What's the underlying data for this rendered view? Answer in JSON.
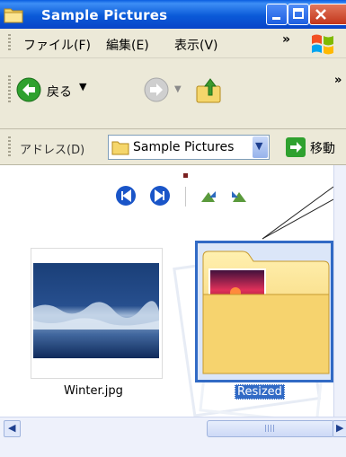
{
  "window": {
    "title": "Sample Pictures",
    "titlebar_color": "#0a5ee0"
  },
  "menu": {
    "items": [
      "ファイル(F)",
      "編集(E)",
      "表示(V)"
    ],
    "overflow": "»"
  },
  "toolbar": {
    "back_label": "戻る",
    "overflow": "»"
  },
  "address": {
    "label": "アドレス(D)",
    "value": "Sample Pictures",
    "go_label": "移動"
  },
  "content": {
    "items": [
      {
        "name": "Winter.jpg",
        "type": "image",
        "selected": false
      },
      {
        "name": "Resized",
        "type": "folder",
        "selected": true
      }
    ],
    "selection_color": "#316ac5"
  }
}
